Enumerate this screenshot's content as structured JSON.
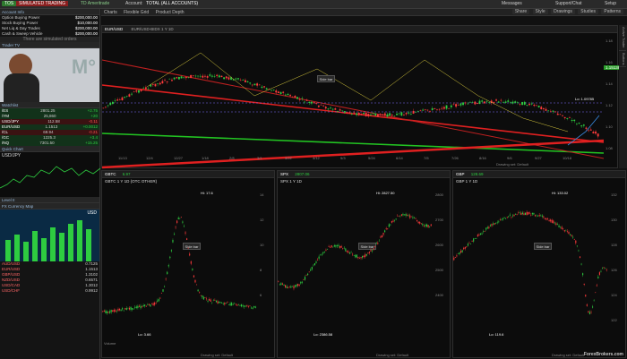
{
  "topbar": {
    "logo": "TOS",
    "mode": "SIMULATED TRADING",
    "company": "TD Ameritrade",
    "account": "Account:",
    "account_value": "TOTAL (ALL ACCOUNTS)",
    "tabs": [
      "Monitor",
      "Trade",
      "Analyze",
      "Scan",
      "MarketWatch",
      "Charts",
      "Tools",
      "Education",
      "Help"
    ],
    "right": [
      "Messages",
      "Support/Chat",
      "Setup"
    ]
  },
  "left": {
    "account_header": "Account Info",
    "account_rows": [
      {
        "label": "Option Buying Power",
        "value": "$200,000.00"
      },
      {
        "label": "Stock Buying Power",
        "value": "$10,000.00"
      },
      {
        "label": "Net Liq & Day Trades",
        "value": "$200,000.00"
      },
      {
        "label": "Cash & Sweep Vehicle",
        "value": "$200,000.00"
      }
    ],
    "notice": "There are simulated orders",
    "tv_header": "Trader TV",
    "watchlist_header": "Watchlist",
    "watch_rows": [
      {
        "symbol": "/ES",
        "value": "2801.25",
        "change": "+2.75"
      },
      {
        "symbol": "/YM",
        "value": "25,860",
        "change": "+20"
      },
      {
        "symbol": "USD/JPY",
        "value": "112.58",
        "change": "-0.11"
      },
      {
        "symbol": "EUR/USD",
        "value": "1.1513",
        "change": "+0.0012"
      },
      {
        "symbol": "/CL",
        "value": "69.94",
        "change": "-0.21"
      },
      {
        "symbol": "/GC",
        "value": "1225.3",
        "change": "+3.4"
      },
      {
        "symbol": "/NQ",
        "value": "7301.50",
        "change": "+15.25"
      }
    ],
    "quick_chart_header": "Quick Chart",
    "quick_chart_symbol": "USD/JPY",
    "level2_header": "Level II",
    "fx_header": "FX Currency Map",
    "fx_symbol": "USD",
    "fx_rows": [
      {
        "pair": "AUD/USD",
        "val": "0.7125"
      },
      {
        "pair": "EUR/USD",
        "val": "1.1513"
      },
      {
        "pair": "GBP/USD",
        "val": "1.3102"
      },
      {
        "pair": "NZD/USD",
        "val": "0.6571"
      },
      {
        "pair": "USD/CAD",
        "val": "1.3012"
      },
      {
        "pair": "USD/CHF",
        "val": "0.9912"
      }
    ]
  },
  "charts": {
    "menu_tabs": [
      "Charts",
      "Flexible Grid",
      "Product Depth"
    ],
    "top_right": [
      "Share",
      "Style",
      "Drawings",
      "Studies",
      "Patterns"
    ],
    "main_symbol": "EUR/USD",
    "main_timeframe": "EUR/USD-BIDX 1 Y 1D",
    "main_price": "1.15138",
    "main_low_label": "Lo: 1.09785",
    "main_dates": [
      "11/13",
      "12/4",
      "12/27",
      "1/18",
      "2/8",
      "3/1",
      "3/22",
      "4/12",
      "5/3",
      "5/24",
      "6/14",
      "7/5",
      "7/26",
      "8/16",
      "9/6",
      "9/27",
      "10/18"
    ],
    "main_prices": [
      "1.18",
      "1.16",
      "1.14",
      "1.12",
      "1.10",
      "1.08"
    ],
    "sidebar_label": "Side bar",
    "drawing_set": "Drawing set: Default",
    "sub": [
      {
        "symbol": "GBTC",
        "title": "GBTC 1 Y 1D (OTC OTHER)",
        "price": "6.97",
        "hi": "Hi: 17.6",
        "lo": "Lo: 3.66",
        "ticks": [
          "14",
          "12",
          "10",
          "8",
          "6"
        ],
        "volume_label": "Volume"
      },
      {
        "symbol": "SPX",
        "title": "SPX 1 Y 1D",
        "price": "2807.06",
        "hi": "Hi: 2827.50",
        "lo": "Lo: 2386.58",
        "ticks": [
          "2800",
          "2700",
          "2600",
          "2500",
          "2400"
        ]
      },
      {
        "symbol": "GBP",
        "title": "GBP 1 Y 1D",
        "price": "128.69",
        "hi": "Hi: 133.02",
        "lo": "Lo: 119.6",
        "ticks": [
          "132",
          "130",
          "128",
          "126",
          "124",
          "122"
        ]
      }
    ],
    "watermark": "ForexBrokers.com"
  },
  "colors": {
    "up": "#2ecc40",
    "down": "#ff3b3b",
    "accent": "#3a8ee6",
    "trend_red": "#e02020",
    "trend_green": "#22c422"
  }
}
